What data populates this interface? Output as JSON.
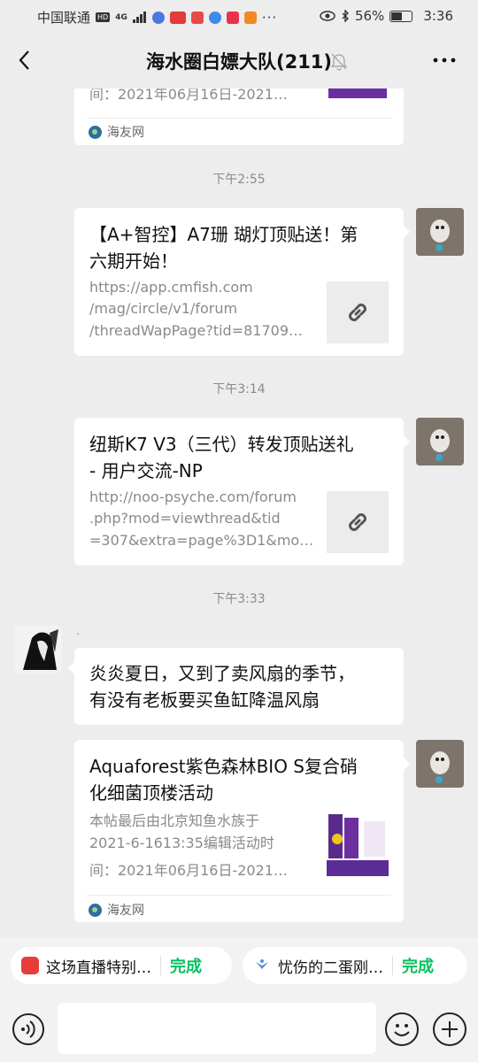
{
  "status_bar": {
    "carrier": "中国联通",
    "network_badge": "HD",
    "signal_badge": "4G",
    "battery": "56%",
    "time": "3:36"
  },
  "header": {
    "title": "海水圈白嫖大队(211)"
  },
  "messages": {
    "top_card": {
      "desc_last_line": "间：2021年06月16日-2021…",
      "source": "海友网"
    },
    "time1": "下午2:55",
    "link1": {
      "title_line1": "【A+智控】A7珊 瑚灯顶贴送！第",
      "title_line2": "六期开始！",
      "url_line1": "https://app.cmfish.com",
      "url_line2": "/mag/circle/v1/forum",
      "url_line3": "/threadWapPage?tid=81709…"
    },
    "time2": "下午3:14",
    "link2": {
      "title_line1": "纽斯K7 V3（三代）转发顶贴送礼",
      "title_line2": "- 用户交流-NP",
      "url_line1": "http://noo-psyche.com/forum",
      "url_line2": ".php?mod=viewthread&tid",
      "url_line3": "=307&extra=page%3D1&mo…"
    },
    "time3": "下午3:33",
    "text_msg": {
      "sender_name": ".",
      "line1": "炎炎夏日，又到了卖风扇的季节，",
      "line2": "有没有老板要买鱼缸降温风扇"
    },
    "article": {
      "title_line1": "Aquaforest紫色森林BIO S复合硝",
      "title_line2": "化细菌顶楼活动",
      "desc_line1": "本帖最后由北京知鱼水族于",
      "desc_line2": "2021-6-1613:35编辑活动时",
      "desc_line3": "间：2021年06月16日-2021…",
      "source": "海友网"
    }
  },
  "quick_bar": {
    "item1_text": "这场直播特别…",
    "item1_action": "完成",
    "item2_text": "忧伤的二蛋刚…",
    "item2_action": "完成"
  },
  "input": {
    "placeholder": ""
  },
  "colors": {
    "background": "#ededed",
    "done_green": "#07c160",
    "time_gray": "#8a8a8a"
  }
}
